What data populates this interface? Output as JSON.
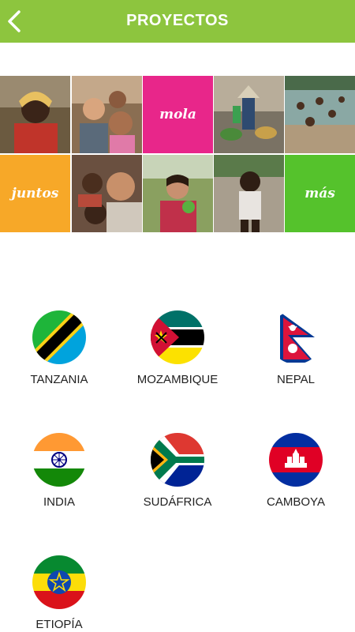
{
  "header": {
    "title": "PROYECTOS",
    "back_icon": "chevron-left-icon",
    "color": "#8dc53e"
  },
  "mosaic": {
    "words": [
      {
        "text": "mola",
        "color": "#e8268a"
      },
      {
        "text": "juntos",
        "color": "#f7a828"
      },
      {
        "text": "más",
        "color": "#55c22c"
      }
    ]
  },
  "countries": [
    {
      "name": "TANZANIA",
      "flag": "tanzania-flag-icon"
    },
    {
      "name": "MOZAMBIQUE",
      "flag": "mozambique-flag-icon"
    },
    {
      "name": "NEPAL",
      "flag": "nepal-flag-icon"
    },
    {
      "name": "INDIA",
      "flag": "india-flag-icon"
    },
    {
      "name": "SUDÁFRICA",
      "flag": "south-africa-flag-icon"
    },
    {
      "name": "CAMBOYA",
      "flag": "cambodia-flag-icon"
    },
    {
      "name": "ETIOPÍA",
      "flag": "ethiopia-flag-icon"
    }
  ]
}
